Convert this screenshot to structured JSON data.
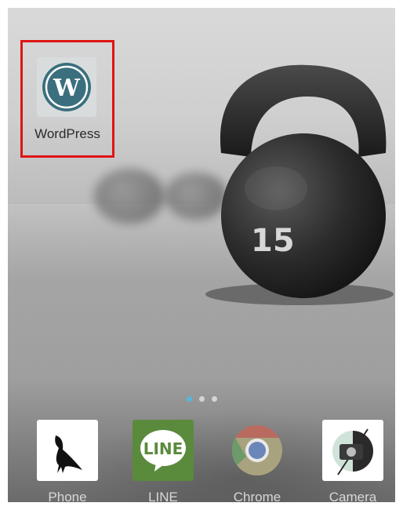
{
  "home_screen": {
    "highlighted_app": {
      "label": "WordPress",
      "icon": "wordpress-icon"
    },
    "wallpaper_text": "15",
    "page_indicator": {
      "pages": 3,
      "current": 1
    },
    "dock": [
      {
        "label": "Phone",
        "icon": "phone-bird-icon"
      },
      {
        "label": "LINE",
        "icon": "line-icon",
        "icon_text": "LINE"
      },
      {
        "label": "Chrome",
        "icon": "chrome-icon"
      },
      {
        "label": "Camera",
        "icon": "camera-icon"
      }
    ]
  },
  "colors": {
    "selection": "#e01414",
    "wordpress": "#21759b",
    "line": "#5a8a3c",
    "page_dot_active": "#58b6d8"
  }
}
